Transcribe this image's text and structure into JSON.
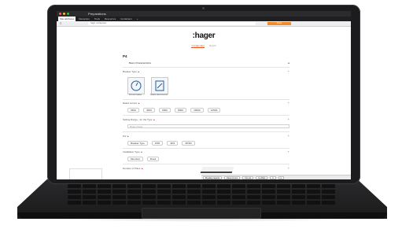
{
  "window": {
    "title": "Preparations"
  },
  "tabs": [
    "Site attributes",
    "Reception",
    "Tools",
    "Resources",
    "Containers",
    "+"
  ],
  "address_bar": {
    "url": "hager configurator",
    "action_label": "Share"
  },
  "page": {
    "brand": ":hager",
    "tabs": [
      {
        "label": "Configurator",
        "active": true
      },
      {
        "label": "Result",
        "active": false
      }
    ],
    "section_code": "P4",
    "basic_characteristics": "Basic Characteristics",
    "breaker_type_label": "Breaker Type",
    "breaker_types": [
      {
        "name": "Circuit breaker",
        "icon": "breaker-icon"
      },
      {
        "name": "Switch-disconnector",
        "icon": "switch-icon"
      }
    ],
    "rated_current_label": "Rated current",
    "rated_currents": [
      "250A",
      "400A",
      "630A",
      "800A",
      "1000A",
      "1250A"
    ],
    "setting_range_label": "Setting Range - for the Type",
    "setting_placeholder": "Please choose",
    "poles_label": "Pol",
    "poles": [
      "Breaker Type",
      "3/3N",
      "4P/4",
      "4P/4N"
    ],
    "installation_type_label": "Installation Type",
    "installation_types": [
      "Mounted",
      "Fixed"
    ],
    "number_of_poles_label": "Number of Poles"
  },
  "status_bar": {
    "items": [
      "Breaking capacity",
      "Rated current",
      "Trip unit",
      "Icu 50kA",
      "0",
      "0"
    ]
  },
  "colors": {
    "accent": "#e2531c",
    "required": "#d32f2f",
    "orange_button": "#f08c2a"
  }
}
